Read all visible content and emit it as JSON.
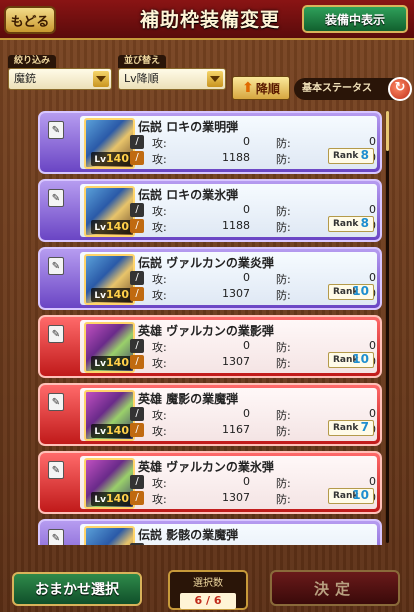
{
  "header": {
    "back_label": "もどる",
    "title": "補助枠装備変更",
    "equip_toggle_label": "装備中表示"
  },
  "filter": {
    "label": "絞り込み",
    "value": "魔銃"
  },
  "sort": {
    "label": "並び替え",
    "value": "Lv降順",
    "direction_label": "降順"
  },
  "status_toggle_label": "基本ステータス",
  "stat_labels": {
    "atk": "攻:",
    "def": "防:"
  },
  "items": [
    {
      "rarity": "legend",
      "name": "伝説 ロキの業明弾",
      "level_prefix": "Lv",
      "level": "140",
      "row1": {
        "atk": "0",
        "def": "0"
      },
      "row2": {
        "atk": "1188",
        "def": "0"
      },
      "rank_label": "Rank",
      "rank": "8"
    },
    {
      "rarity": "legend",
      "name": "伝説 ロキの業氷弾",
      "level_prefix": "Lv",
      "level": "140",
      "row1": {
        "atk": "0",
        "def": "0"
      },
      "row2": {
        "atk": "1188",
        "def": "0"
      },
      "rank_label": "Rank",
      "rank": "8"
    },
    {
      "rarity": "legend",
      "name": "伝説 ヴァルカンの業炎弾",
      "level_prefix": "Lv",
      "level": "140",
      "row1": {
        "atk": "0",
        "def": "0"
      },
      "row2": {
        "atk": "1307",
        "def": "0"
      },
      "rank_label": "Rank",
      "rank": "10"
    },
    {
      "rarity": "hero",
      "name": "英雄 ヴァルカンの業影弾",
      "level_prefix": "Lv",
      "level": "140",
      "row1": {
        "atk": "0",
        "def": "0"
      },
      "row2": {
        "atk": "1307",
        "def": "0"
      },
      "rank_label": "Rank",
      "rank": "10"
    },
    {
      "rarity": "hero",
      "name": "英雄 魔影の業魔弾",
      "level_prefix": "Lv",
      "level": "140",
      "row1": {
        "atk": "0",
        "def": "0"
      },
      "row2": {
        "atk": "1167",
        "def": "0"
      },
      "rank_label": "Rank",
      "rank": "7"
    },
    {
      "rarity": "hero",
      "name": "英雄 ヴァルカンの業氷弾",
      "level_prefix": "Lv",
      "level": "140",
      "row1": {
        "atk": "0",
        "def": "0"
      },
      "row2": {
        "atk": "1307",
        "def": "0"
      },
      "rank_label": "Rank",
      "rank": "10"
    },
    {
      "rarity": "legend",
      "name": "伝説 影骸の業魔弾",
      "level_prefix": "Lv",
      "level": "140",
      "row1": {
        "atk": "0",
        "def": "0"
      },
      "row2": {
        "atk": "",
        "def": ""
      },
      "rank_label": "Rank",
      "rank": ""
    }
  ],
  "footer": {
    "auto_select_label": "おまかせ選択",
    "count_label": "選択数",
    "count_value": "6 / 6",
    "decide_label": "決定"
  },
  "colors": {
    "legend": "#7a55d0",
    "hero": "#d02a2a",
    "header": "#8a1414",
    "accent_green": "#1f7a3e"
  }
}
